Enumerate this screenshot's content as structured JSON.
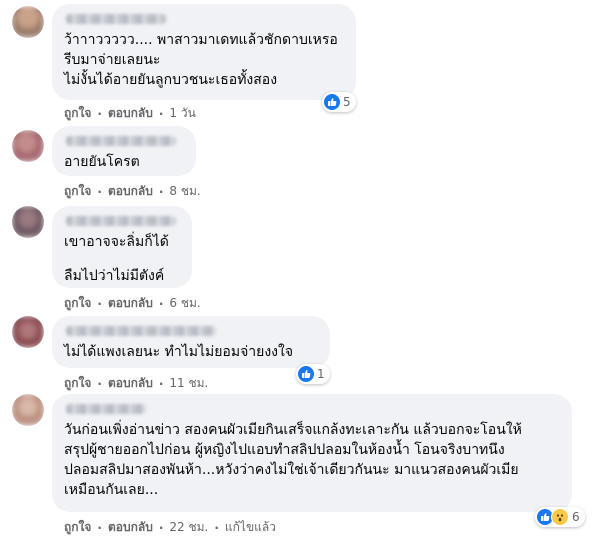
{
  "comments": [
    {
      "text": "ว้าาาววววว.... พาสาวมาเดทแล้วชักดาบเหรอ\nรีบมาจ่ายเลยนะ\nไม่งั้นได้อายยันลูกบวชนะเธอทั้งสอง",
      "like_label": "ถูกใจ",
      "reply_label": "ตอบกลับ",
      "time": "1 วัน",
      "reaction_count": "5",
      "reaction_icon": "like-icon"
    },
    {
      "text": "อายยันโครต",
      "like_label": "ถูกใจ",
      "reply_label": "ตอบกลับ",
      "time": "8 ชม."
    },
    {
      "text": "เขาอาจจะลิ่มก็ได้\n\nลืมไปว่าไม่มีตังค์",
      "like_label": "ถูกใจ",
      "reply_label": "ตอบกลับ",
      "time": "6 ชม."
    },
    {
      "text": "ไม่ได้แพงเลยนะ ทำไมไม่ยอมจ่ายงงใจ",
      "like_label": "ถูกใจ",
      "reply_label": "ตอบกลับ",
      "time": "11 ชม.",
      "reaction_count": "1",
      "reaction_icon": "like-icon"
    },
    {
      "text": "วันก่อนเพิ่งอ่านข่าว สองคนผัวเมียกินเสร็จแกล้งทะเลาะกัน แล้วบอกจะโอนให้\nสรุปผู้ชายออกไปก่อน ผู้หญิงไปแอบทำสลิปปลอมในห้องน้ำ โอนจริงบาทนึง\nปลอมสลิปมาสองพันห้า...หวังว่าคงไม่ใช่เจ้าเดียวกันนะ มาแนวสองคนผัวเมีย\nเหมือนกันเลย...",
      "like_label": "ถูกใจ",
      "reply_label": "ตอบกลับ",
      "time": "22 ชม.",
      "edited_label": "แก้ไขแล้ว",
      "reaction_count": "6",
      "reaction_icon": "like-icon",
      "reaction_icon_2": "wow-icon"
    }
  ],
  "colors": {
    "bubble": "#f0f2f5",
    "like": "#1877f2",
    "meta_text": "#65676b",
    "body_text": "#050505"
  }
}
